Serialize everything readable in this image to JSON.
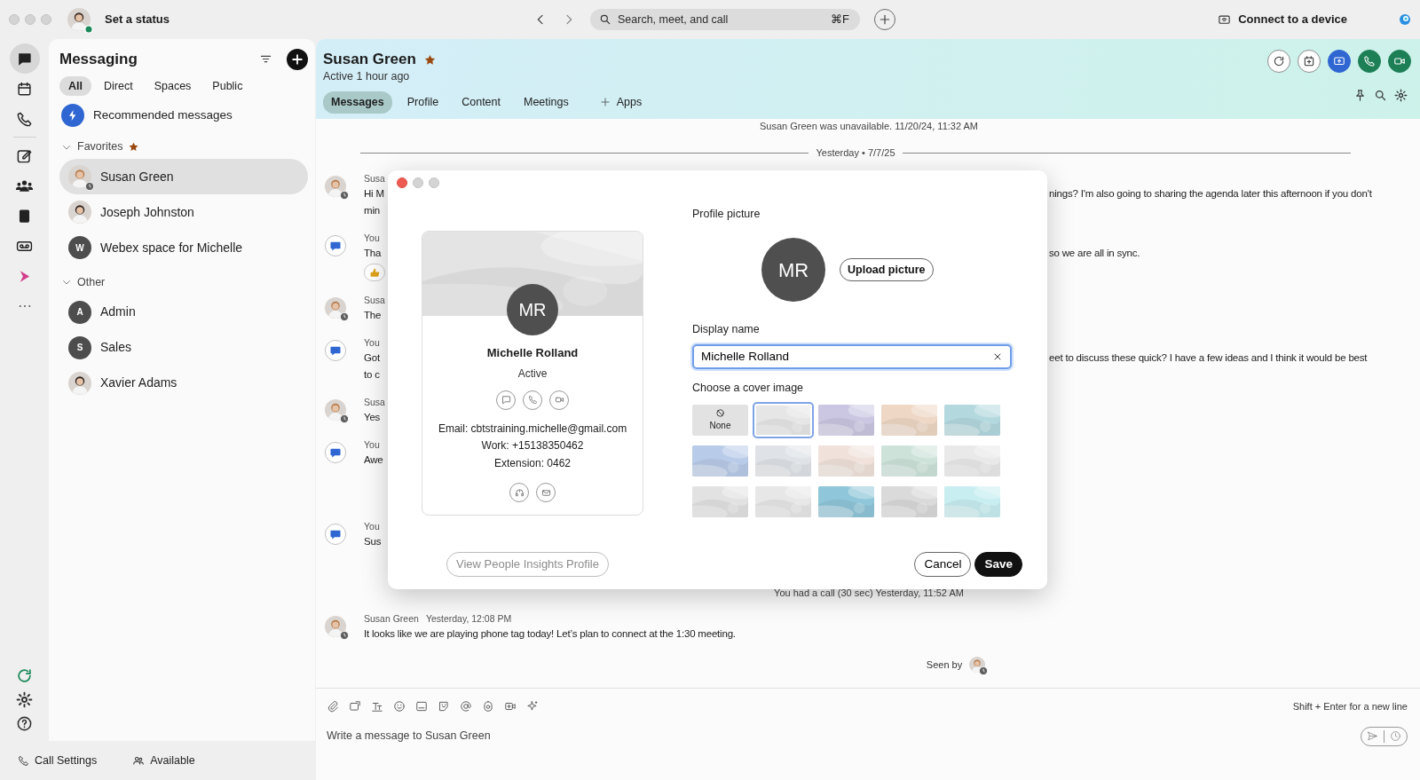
{
  "app_bar": {
    "status_prompt": "Set a status",
    "user_online": true,
    "search": {
      "placeholder": "Search, meet, and call",
      "shortcut": "⌘F"
    },
    "connect": "Connect to a device"
  },
  "rail": [
    {
      "selected": true
    },
    {
      "selected": false
    },
    {
      "selected": false
    },
    {
      "selected": false
    },
    {
      "selected": false
    },
    {
      "selected": false
    },
    {
      "selected": false
    },
    {
      "selected": false
    }
  ],
  "sidebar": {
    "title": "Messaging",
    "filters": [
      {
        "label": "All",
        "selected": true
      },
      {
        "label": "Direct",
        "selected": false
      },
      {
        "label": "Spaces",
        "selected": false
      },
      {
        "label": "Public",
        "selected": false
      }
    ],
    "recommended": "Recommended messages",
    "groups": [
      {
        "label": "Favorites",
        "expanded": true,
        "favorite": true,
        "items": [
          {
            "name": "Susan Green",
            "away": true,
            "selected": true
          },
          {
            "name": "Joseph Johnston",
            "away": false,
            "selected": false
          },
          {
            "name": "Webex space for Michelle",
            "kind": "initial",
            "initial": "W",
            "away": false,
            "selected": false
          }
        ]
      },
      {
        "label": "Other",
        "expanded": true,
        "favorite": false,
        "items": [
          {
            "name": "Admin",
            "kind": "initial",
            "initial": "A",
            "away": false,
            "selected": false
          },
          {
            "name": "Sales",
            "kind": "initial",
            "initial": "S",
            "away": false,
            "selected": false
          },
          {
            "name": "Xavier Adams",
            "away": false,
            "selected": false
          }
        ]
      }
    ]
  },
  "footer": {
    "call_settings": "Call Settings",
    "availability": "Available"
  },
  "conversation": {
    "name": "Susan Green",
    "favorite": true,
    "status": "Active 1 hour ago",
    "tabs": [
      {
        "label": "Messages",
        "selected": true
      },
      {
        "label": "Profile",
        "selected": false
      },
      {
        "label": "Content",
        "selected": false
      },
      {
        "label": "Meetings",
        "selected": false
      },
      {
        "label": "Apps",
        "kind": "add",
        "selected": false
      }
    ],
    "messages": [
      {
        "kind": "system",
        "text": "Susan Green was unavailable. 11/20/24, 11:32 AM"
      },
      {
        "kind": "divider",
        "text": "Yesterday • 7/7/25"
      },
      {
        "kind": "message",
        "self": false,
        "away": true,
        "name": "Susa",
        "lines": [
          {
            "left": "Hi M",
            "right": "nings? I'm also going to sharing the agenda later this afternoon if you don't"
          },
          {
            "left": "min"
          }
        ]
      },
      {
        "kind": "message",
        "self": true,
        "away": false,
        "name": "You",
        "lines": [
          {
            "left": "Tha",
            "right": "so we are all in sync."
          }
        ],
        "reaction": true
      },
      {
        "kind": "message",
        "self": false,
        "away": true,
        "name": "Susa",
        "lines": [
          {
            "left": "The"
          }
        ]
      },
      {
        "kind": "message",
        "self": true,
        "away": false,
        "name": "You",
        "lines": [
          {
            "left": "Got",
            "right": "eet to discuss these quick? I have a few ideas and I think it would be best"
          },
          {
            "left": "to c"
          }
        ]
      },
      {
        "kind": "message",
        "self": false,
        "away": true,
        "name": "Susa",
        "lines": [
          {
            "left": "Yes"
          }
        ]
      },
      {
        "kind": "message",
        "self": true,
        "away": false,
        "name": "You",
        "lines": [
          {
            "left": "Awe"
          }
        ]
      },
      {
        "kind": "message",
        "self": true,
        "away": false,
        "name": "You",
        "lines": [
          {
            "left": "Sus"
          }
        ]
      },
      {
        "kind": "system",
        "text": "You had a call (30 sec) Yesterday, 11:52 AM"
      },
      {
        "kind": "message",
        "self": false,
        "away": true,
        "name": "Susan Green",
        "time": "Yesterday, 12:08 PM",
        "lines": [
          {
            "text": "It looks like we are playing phone tag today! Let’s plan to connect at the 1:30 meeting."
          }
        ]
      }
    ],
    "seen_by": {
      "label": "Seen by",
      "away": true
    },
    "composer": {
      "hint": "Shift + Enter for a new line",
      "placeholder": "Write a message to Susan Green"
    }
  },
  "dialog": {
    "card": {
      "initials": "MR",
      "name": "Michelle Rolland",
      "status": "Active",
      "fields": [
        "Email: cbtstraining.michelle@gmail.com",
        "Work: +15138350462",
        "Extension: 0462"
      ]
    },
    "insights_button": "View People Insights Profile",
    "picture_label": "Profile picture",
    "initials": "MR",
    "upload": "Upload picture",
    "display_name_label": "Display name",
    "display_name": "Michelle Rolland",
    "cover_label": "Choose a cover image",
    "covers": [
      {
        "kind": "none",
        "label": "None",
        "selected": false
      },
      {
        "kind": "picture",
        "selected": true
      },
      {
        "kind": "picture",
        "selected": false
      },
      {
        "kind": "picture",
        "selected": false
      },
      {
        "kind": "picture",
        "selected": false
      },
      {
        "kind": "picture",
        "selected": false
      },
      {
        "kind": "picture",
        "selected": false
      },
      {
        "kind": "picture",
        "selected": false
      },
      {
        "kind": "picture",
        "selected": false
      },
      {
        "kind": "picture",
        "selected": false
      },
      {
        "kind": "picture",
        "selected": false
      },
      {
        "kind": "picture",
        "selected": false
      },
      {
        "kind": "picture",
        "selected": false
      },
      {
        "kind": "picture",
        "selected": false
      },
      {
        "kind": "picture",
        "selected": false
      }
    ],
    "cancel": "Cancel",
    "save": "Save"
  }
}
